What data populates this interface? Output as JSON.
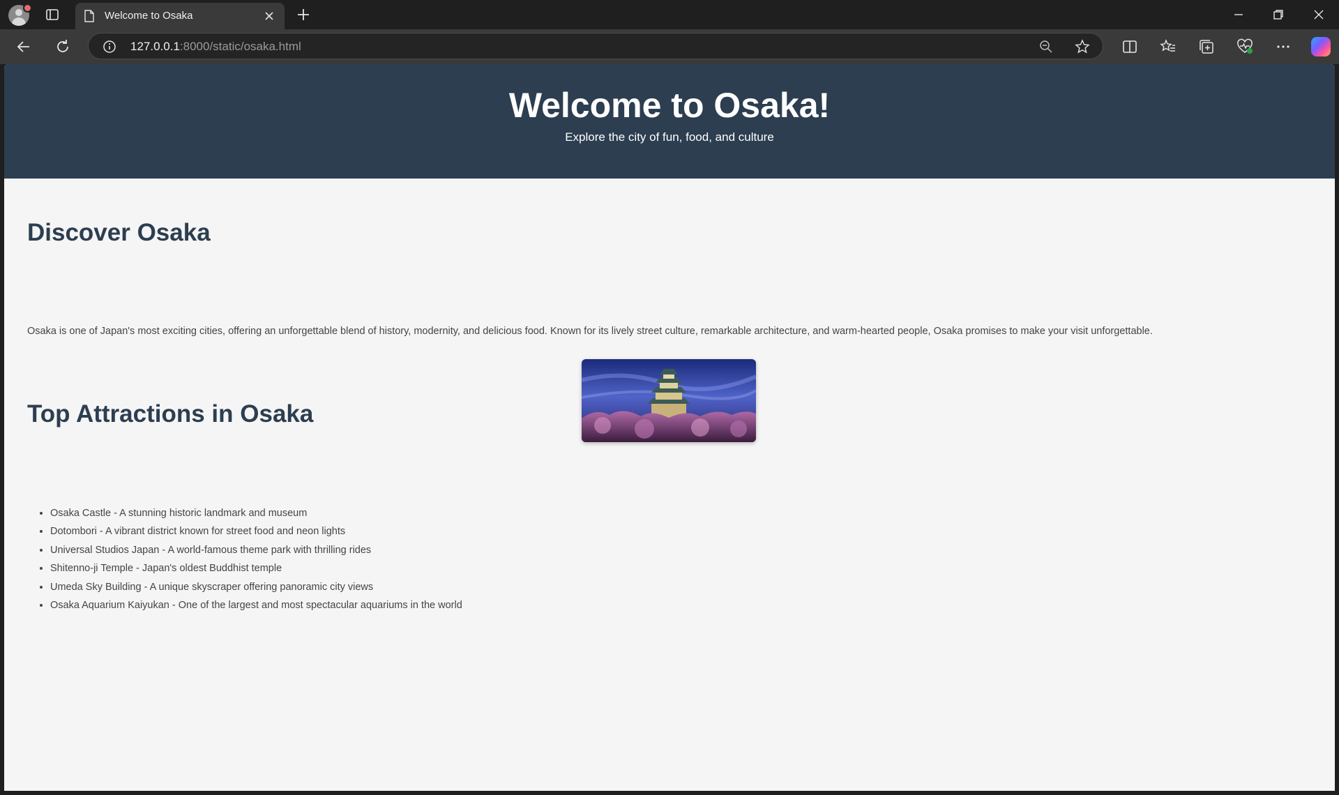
{
  "browser": {
    "tab_title": "Welcome to Osaka",
    "url_host": "127.0.0.1",
    "url_rest": ":8000/static/osaka.html"
  },
  "page": {
    "hero": {
      "title": "Welcome to Osaka!",
      "subtitle": "Explore the city of fun, food, and culture"
    },
    "discover": {
      "heading": "Discover Osaka",
      "text": "Osaka is one of Japan's most exciting cities, offering an unforgettable blend of history, modernity, and delicious food. Known for its lively street culture, remarkable architecture, and warm-hearted people, Osaka promises to make your visit unforgettable."
    },
    "attractions": {
      "heading": "Top Attractions in Osaka",
      "items": [
        "Osaka Castle - A stunning historic landmark and museum",
        "Dotombori - A vibrant district known for street food and neon lights",
        "Universal Studios Japan - A world-famous theme park with thrilling rides",
        "Shitenno-ji Temple - Japan's oldest Buddhist temple",
        "Umeda Sky Building - A unique skyscraper offering panoramic city views",
        "Osaka Aquarium Kaiyukan - One of the largest and most spectacular aquariums in the world"
      ]
    }
  },
  "colors": {
    "hero_bg": "#2c3e50",
    "heading": "#2c3e50",
    "page_bg": "#f5f5f5"
  },
  "icons": {
    "photo": "osaka-castle-photo"
  }
}
